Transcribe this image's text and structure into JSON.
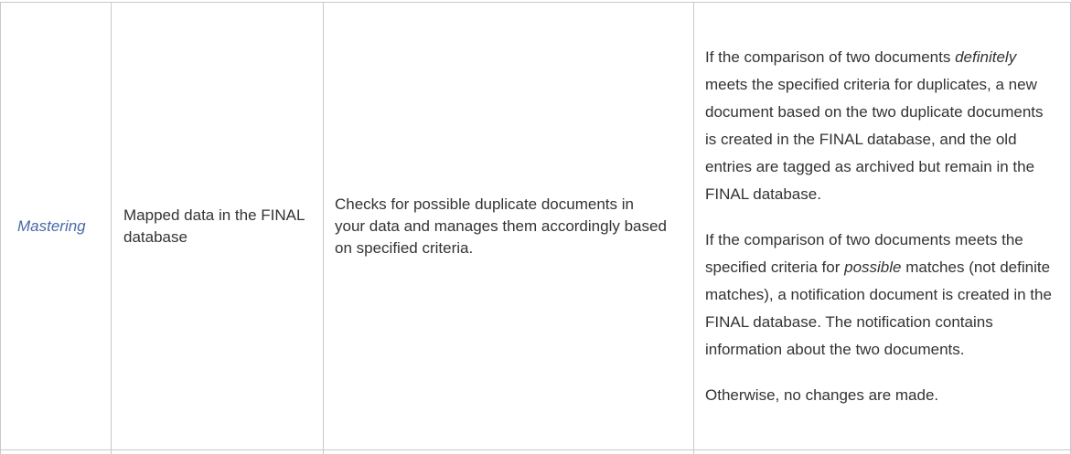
{
  "row": {
    "stage": "Mastering",
    "input": "Mapped data in the FINAL database",
    "description": "Checks for possible duplicate documents in your data and manages them accordingly based on specified criteria.",
    "result": {
      "p1_a": "If the comparison of two documents ",
      "p1_em": "definitely",
      "p1_b": " meets the specified criteria for duplicates, a new document based on the two duplicate documents is created in the FINAL database, and the old entries are tagged as archived but remain in the FINAL database.",
      "p2_a": "If the comparison of two documents meets the specified criteria for ",
      "p2_em": "possible",
      "p2_b": " matches (not definite matches), a notification document is created in the FINAL database. The notification contains information about the two documents.",
      "p3": "Otherwise, no changes are made."
    }
  },
  "colors": {
    "border": "#c9c9c9",
    "link": "#4a6aa5",
    "text": "#333333"
  }
}
